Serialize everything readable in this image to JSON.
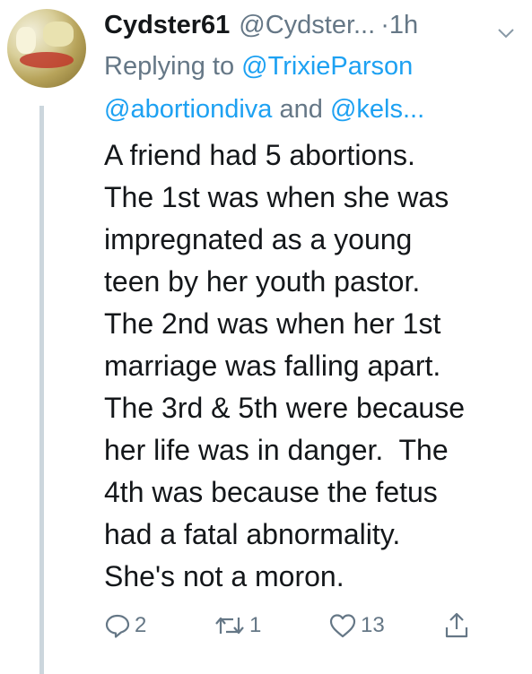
{
  "tweet": {
    "display_name": "Cydster61",
    "handle": "@Cydster...",
    "separator": "·",
    "time": "1h",
    "replying_prefix": "Replying to",
    "replying_to_1": "@TrixieParson",
    "replying_to_2": "@abortiondiva",
    "replying_and": "and",
    "replying_to_3": "@kels...",
    "text_lines": [
      "A friend had 5 abortions.",
      "The 1st was when she was",
      "impregnated as a young",
      "teen by her youth pastor.",
      "The 2nd was when her 1st",
      "marriage was falling apart.",
      "The 3rd & 5th were because",
      "her life was in danger.  The",
      "4th was because the fetus",
      "had a fatal abnormality.",
      "She's not a moron."
    ],
    "actions": {
      "reply_count": "2",
      "retweet_count": "1",
      "like_count": "13"
    }
  },
  "icons": {
    "menu": "chevron-down-icon",
    "reply": "reply-icon",
    "retweet": "retweet-icon",
    "like": "heart-icon",
    "share": "share-icon"
  },
  "colors": {
    "text": "#14171a",
    "secondary": "#657786",
    "link": "#1da1f2",
    "thread_line": "#ccd6dd"
  }
}
